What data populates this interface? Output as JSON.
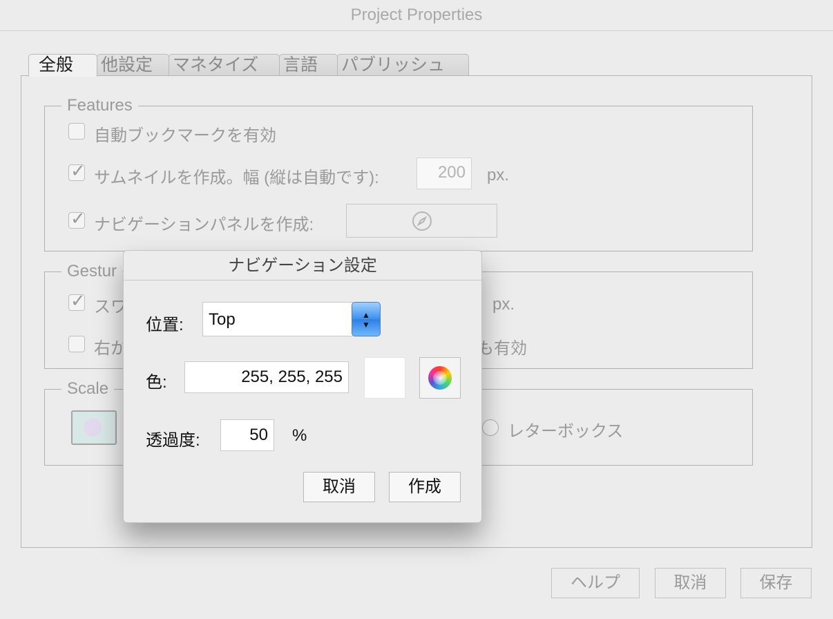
{
  "window": {
    "title": "Project Properties"
  },
  "tabs": [
    {
      "label": "全般",
      "active": true
    },
    {
      "label": "他設定",
      "active": false
    },
    {
      "label": "マネタイズ",
      "active": false
    },
    {
      "label": "言語",
      "active": false
    },
    {
      "label": "パブリッシュ",
      "active": false
    }
  ],
  "features": {
    "title": "Features",
    "auto_bookmark": {
      "label": "自動ブックマークを有効",
      "checked": false
    },
    "thumbnail": {
      "label": "サムネイルを作成。幅 (縦は自動です):",
      "checked": true,
      "width_value": "200",
      "unit": "px."
    },
    "nav_panel": {
      "label": "ナビゲーションパネルを作成:",
      "checked": true,
      "settings_icon": "compass-icon"
    }
  },
  "gestures": {
    "title_visible": "Gestur",
    "row1": {
      "label_visible": "スワ",
      "checked": true,
      "unit": "px."
    },
    "row2": {
      "label_visible": "右か",
      "label_right_visible": "も有効",
      "checked": false
    }
  },
  "scale": {
    "title_visible": "Scale",
    "letterbox": {
      "label": "レターボックス",
      "selected": false
    }
  },
  "footer": {
    "help": "ヘルプ",
    "cancel": "取消",
    "save": "保存"
  },
  "nav_dialog": {
    "title": "ナビゲーション設定",
    "position": {
      "label": "位置:",
      "value": "Top"
    },
    "color": {
      "label": "色:",
      "value": "255, 255, 255",
      "swatch": "#ffffff",
      "picker_icon": "color-wheel-icon"
    },
    "opacity": {
      "label": "透過度:",
      "value": "50",
      "unit": "%"
    },
    "cancel": "取消",
    "create": "作成"
  }
}
